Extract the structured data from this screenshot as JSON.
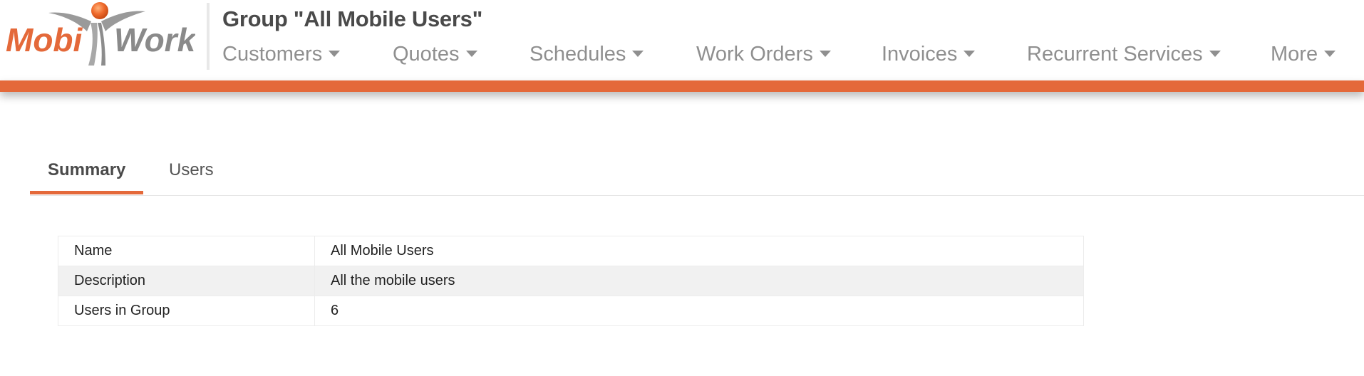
{
  "brand": {
    "logo_text_left": "Mobi",
    "logo_text_right": "Work",
    "accent_color": "#e4693a"
  },
  "page": {
    "title": "Group \"All Mobile Users\""
  },
  "nav": {
    "items": [
      {
        "label": "Customers"
      },
      {
        "label": "Quotes"
      },
      {
        "label": "Schedules"
      },
      {
        "label": "Work Orders"
      },
      {
        "label": "Invoices"
      },
      {
        "label": "Recurrent Services"
      },
      {
        "label": "More"
      }
    ]
  },
  "tabs": [
    {
      "label": "Summary",
      "active": true
    },
    {
      "label": "Users",
      "active": false
    }
  ],
  "details": {
    "rows": [
      {
        "label": "Name",
        "value": "All Mobile Users"
      },
      {
        "label": "Description",
        "value": "All the mobile users"
      },
      {
        "label": "Users in Group",
        "value": "6"
      }
    ]
  }
}
